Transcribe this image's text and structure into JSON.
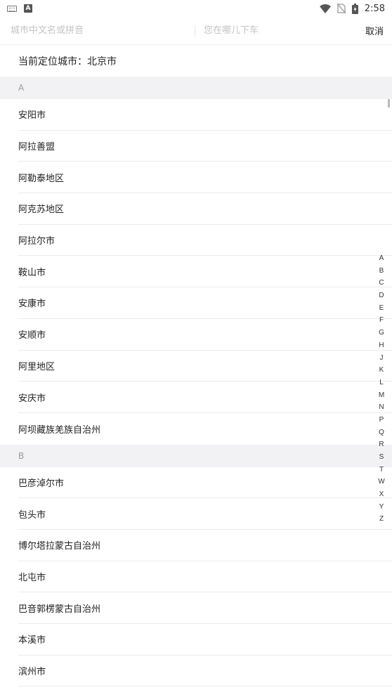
{
  "status_bar": {
    "time": "2:58",
    "input_badge": "A"
  },
  "search": {
    "city_placeholder": "城市中文名或拼音",
    "dest_placeholder": "您在哪儿下车",
    "cancel_label": "取消"
  },
  "current_city": "当前定位城市：北京市",
  "sections": [
    {
      "letter": "A",
      "cities": [
        "安阳市",
        "阿拉善盟",
        "阿勒泰地区",
        "阿克苏地区",
        "阿拉尔市",
        "鞍山市",
        "安康市",
        "安顺市",
        "阿里地区",
        "安庆市",
        "阿坝藏族羌族自治州"
      ]
    },
    {
      "letter": "B",
      "cities": [
        "巴彦淖尔市",
        "包头市",
        "博尔塔拉蒙古自治州",
        "北屯市",
        "巴音郭楞蒙古自治州",
        "本溪市",
        "滨州市"
      ]
    }
  ],
  "index_letters": [
    "A",
    "B",
    "C",
    "D",
    "E",
    "F",
    "G",
    "H",
    "J",
    "K",
    "L",
    "M",
    "N",
    "P",
    "Q",
    "R",
    "S",
    "T",
    "W",
    "X",
    "Y",
    "Z"
  ]
}
